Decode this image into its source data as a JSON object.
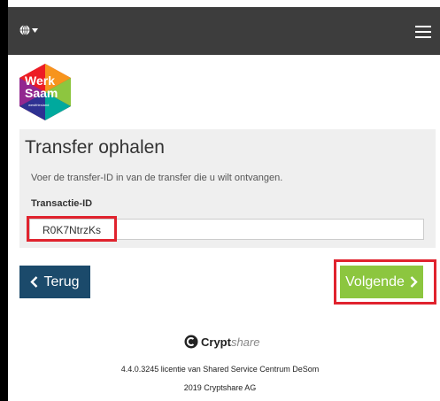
{
  "logo": {
    "line1": "Werk",
    "line2": "Saam",
    "sub": "westfriesland"
  },
  "panel": {
    "title": "Transfer ophalen",
    "description": "Voer de transfer-ID in van de transfer die u wilt ontvangen.",
    "field_label": "Transactie-ID",
    "field_value": "R0K7NtrzKs"
  },
  "buttons": {
    "back": "Terug",
    "next": "Volgende"
  },
  "footer": {
    "brand_bold": "Crypt",
    "brand_light": "share",
    "version": "4.4.0.3245 licentie van Shared Service Centrum DeSom",
    "copyright": "2019 Cryptshare AG"
  },
  "colors": {
    "topbar": "#3d3d3d",
    "back_button": "#1b4a6b",
    "next_button": "#8cc63f",
    "highlight": "#e0232e"
  }
}
